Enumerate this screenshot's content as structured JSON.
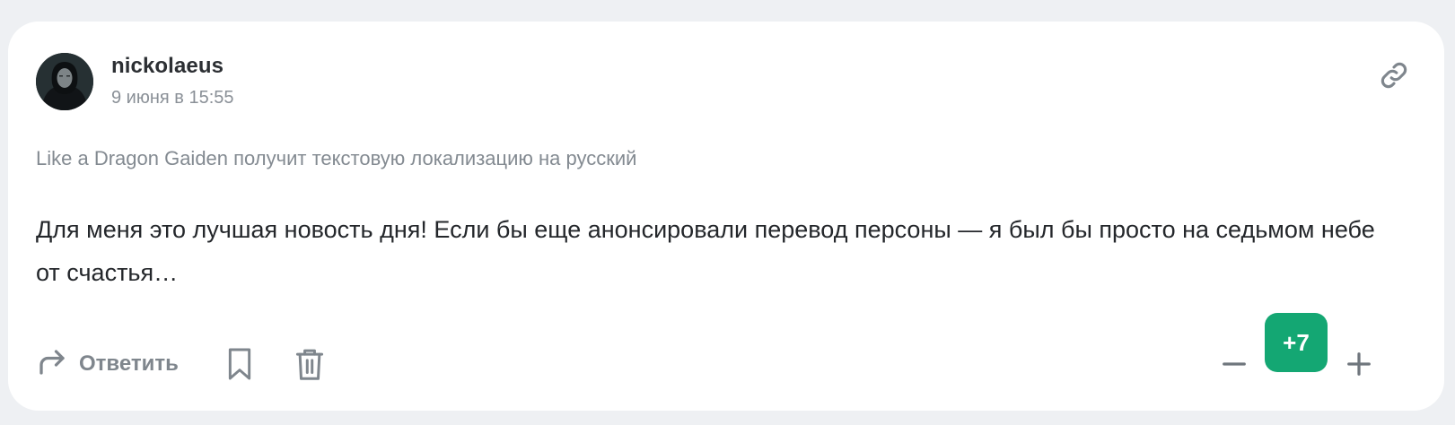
{
  "comment": {
    "author": "nickolaeus",
    "date": "9 июня в 15:55",
    "article_title": "Like a Dragon Gaiden получит текстовую локализацию на русский",
    "text": "Для меня это лучшая новость дня! Если бы еще анонсировали перевод персоны — я был бы просто на седьмом небе от счастья…"
  },
  "actions": {
    "reply_label": "Ответить"
  },
  "rating": {
    "score": "+7"
  },
  "icons": {
    "avatar": "avatar-image",
    "link": "link-icon",
    "reply": "reply-arrow-icon",
    "bookmark": "bookmark-icon",
    "delete": "trash-icon",
    "vote_down": "minus-icon",
    "vote_up": "plus-icon"
  },
  "colors": {
    "background": "#eef0f3",
    "card": "#ffffff",
    "score_bg": "#14a773",
    "muted": "#838a91",
    "text": "#24272b"
  }
}
